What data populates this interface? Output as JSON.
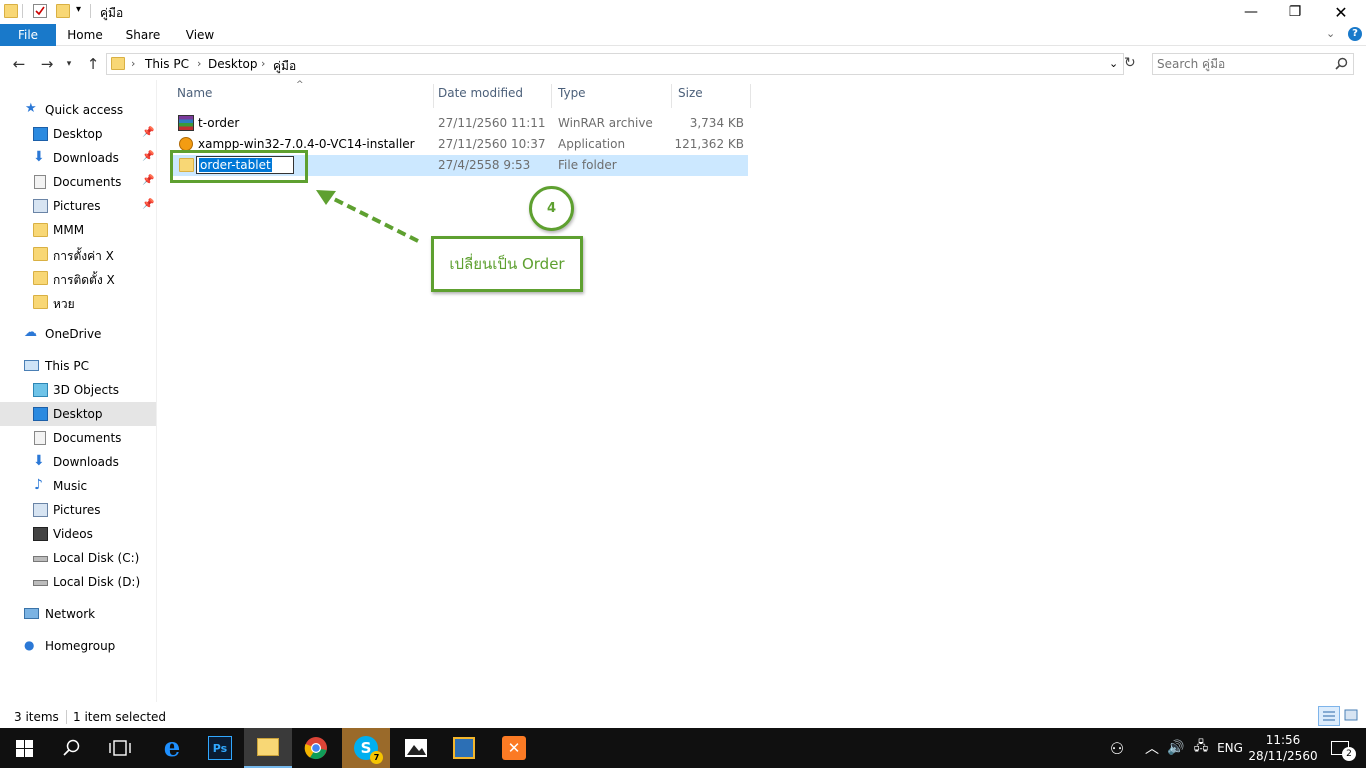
{
  "window": {
    "title": "คู่มือ",
    "controls": {
      "minimize": "—",
      "maximize": "❐",
      "close": "✕"
    }
  },
  "ribbon": {
    "tabs": [
      "File",
      "Home",
      "Share",
      "View"
    ],
    "expand_icon": "chevron-down",
    "help": "?"
  },
  "address": {
    "crumbs": [
      "This PC",
      "Desktop",
      "คู่มือ"
    ],
    "search_placeholder": "Search คู่มือ"
  },
  "nav": {
    "quick_access": "Quick access",
    "quick_items": [
      "Desktop",
      "Downloads",
      "Documents",
      "Pictures",
      "MMM",
      "การตั้งค่า X",
      "การติดตั้ง X",
      "หวย"
    ],
    "onedrive": "OneDrive",
    "this_pc": "This PC",
    "pc_items": [
      "3D Objects",
      "Desktop",
      "Documents",
      "Downloads",
      "Music",
      "Pictures",
      "Videos",
      "Local Disk (C:)",
      "Local Disk (D:)"
    ],
    "network": "Network",
    "homegroup": "Homegroup"
  },
  "columns": {
    "name": "Name",
    "date": "Date modified",
    "type": "Type",
    "size": "Size"
  },
  "files": [
    {
      "name": "t-order",
      "date": "27/11/2560 11:11",
      "type": "WinRAR archive",
      "size": "3,734 KB"
    },
    {
      "name": "xampp-win32-7.0.4-0-VC14-installer",
      "date": "27/11/2560 10:37",
      "type": "Application",
      "size": "121,362 KB"
    },
    {
      "name": "order-tablet",
      "date": "27/4/2558 9:53",
      "type": "File folder",
      "size": ""
    }
  ],
  "status": {
    "count": "3 items",
    "selected": "1 item selected"
  },
  "annotation": {
    "step": "4",
    "note": "เปลี่ยนเป็น Order"
  },
  "taskbar": {
    "lang": "ENG",
    "time": "11:56",
    "date": "28/11/2560",
    "notif": "2",
    "skype_badge": "7"
  },
  "colors": {
    "accent": "#1979ca",
    "selection": "#cce8ff",
    "annotation": "#5ea030"
  }
}
